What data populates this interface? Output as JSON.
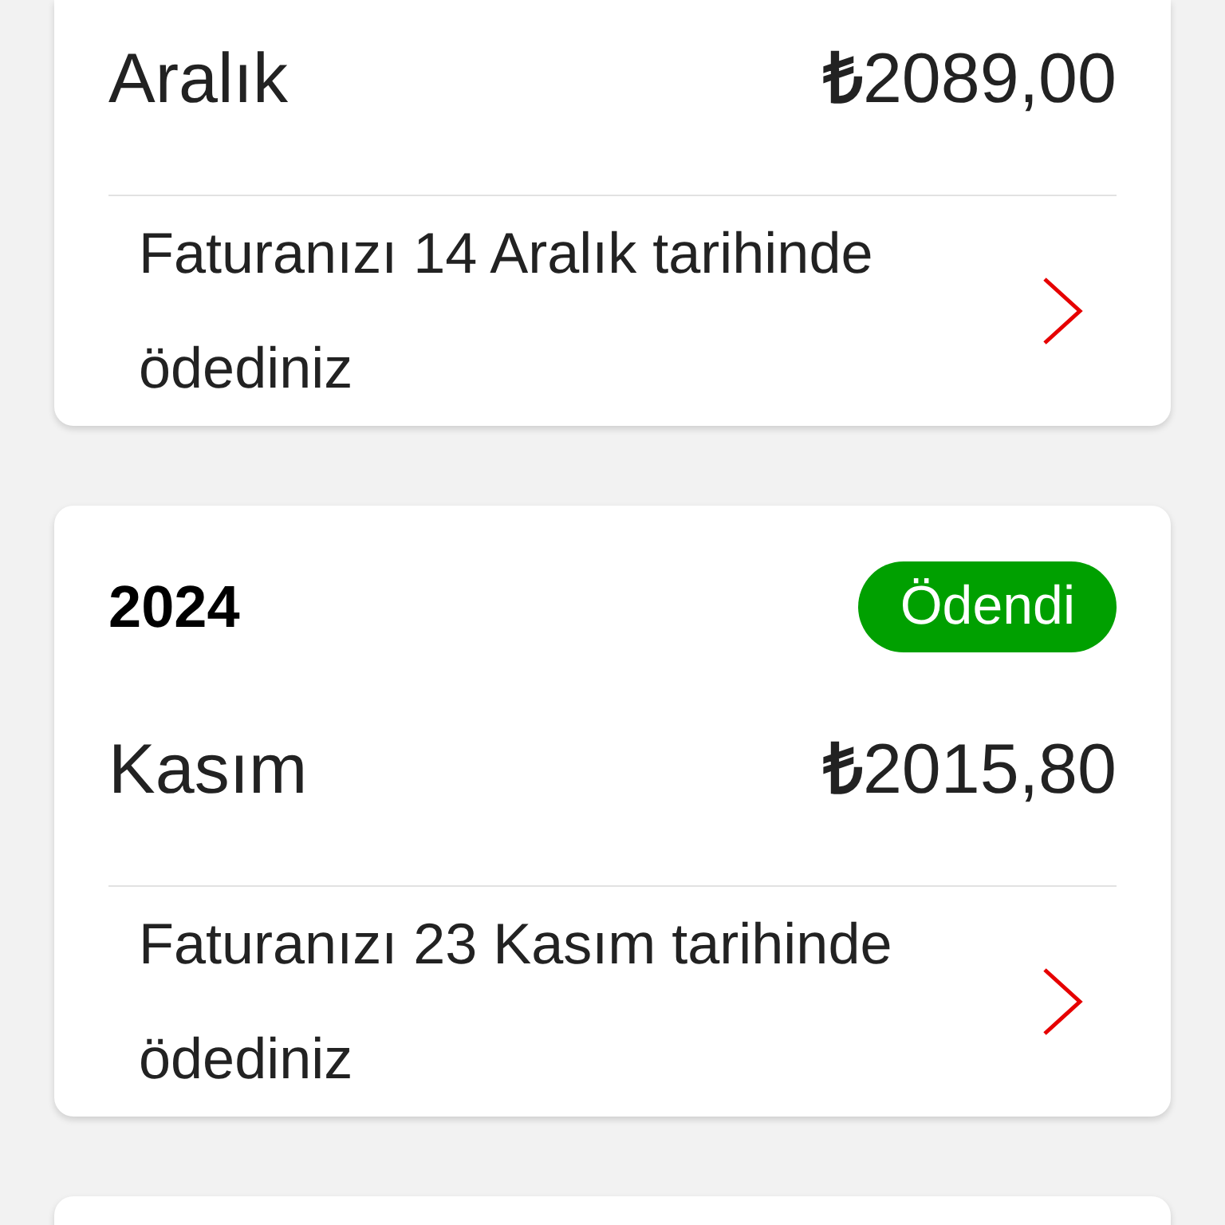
{
  "bills": [
    {
      "month": "Aralık",
      "amount": "**₺**2089,00",
      "description": "Faturanızı 14 Aralık tarihinde ödediniz"
    },
    {
      "year": "2024",
      "status": "Ödendi",
      "month": "Kasım",
      "amount": "**₺**2015,80",
      "description": "Faturanızı 23 Kasım tarihinde ödediniz"
    }
  ]
}
